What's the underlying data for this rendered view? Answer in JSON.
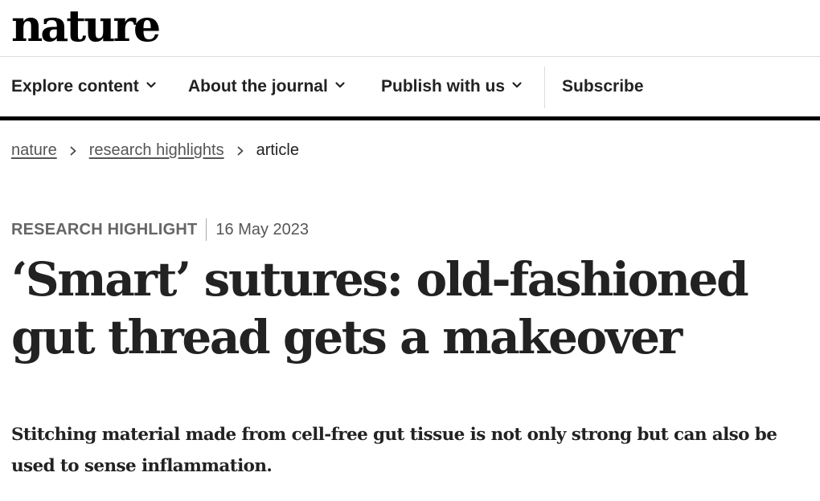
{
  "header": {
    "logo_text": "nature"
  },
  "nav": {
    "items": [
      {
        "label": "Explore content",
        "has_dropdown": true
      },
      {
        "label": "About the journal",
        "has_dropdown": true
      },
      {
        "label": "Publish with us",
        "has_dropdown": true
      },
      {
        "label": "Subscribe",
        "has_dropdown": false
      }
    ]
  },
  "breadcrumb": {
    "items": [
      {
        "label": "nature",
        "is_link": true
      },
      {
        "label": "research highlights",
        "is_link": true
      },
      {
        "label": "article",
        "is_link": false
      }
    ]
  },
  "article": {
    "type": "RESEARCH HIGHLIGHT",
    "date": "16 May 2023",
    "title": "‘Smart’ sutures: old-fashioned gut thread gets a makeover",
    "standfirst": "Stitching material made from cell-free gut tissue is not only strong but can also be used to sense inflammation."
  },
  "icons": {
    "dropdown": "chevron-down-icon",
    "breadcrumb_separator": "chevron-right-icon"
  },
  "colors": {
    "text": "#222222",
    "muted": "#666666",
    "rule": "#000000",
    "divider": "#dcdcdc"
  }
}
